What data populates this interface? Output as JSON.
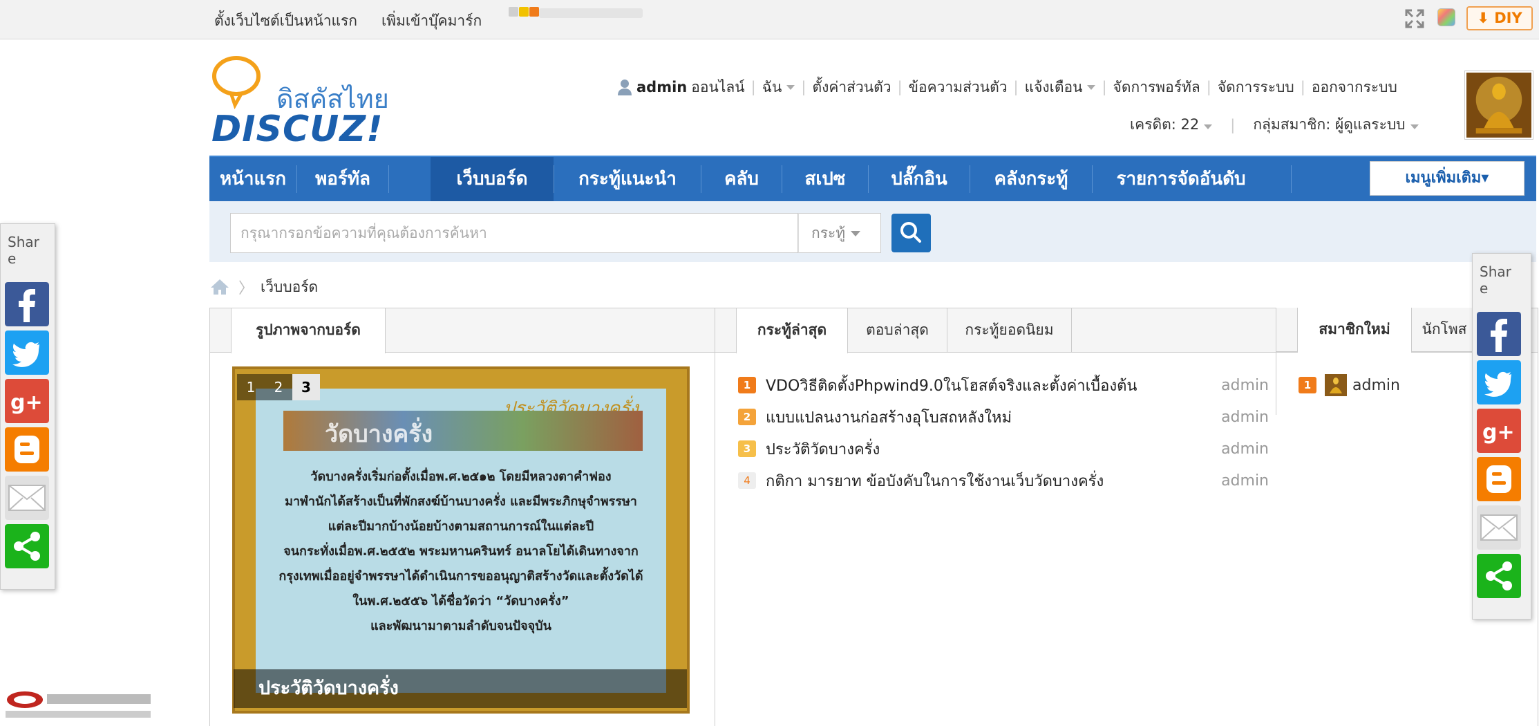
{
  "topbar": {
    "set_homepage": "ตั้งเว็บไซต์เป็นหน้าแรก",
    "add_bookmark": "เพิ่มเข้าบุ๊คมาร์ก",
    "diy_label": "DIY"
  },
  "logo": {
    "thai": "ดิสคัสไทย",
    "text": "DISCUZ!"
  },
  "user_menu": {
    "username": "admin",
    "status": "ออนไลน์",
    "items": [
      "ฉัน",
      "ตั้งค่าส่วนตัว",
      "ข้อความส่วนตัว",
      "แจ้งเตือน",
      "จัดการพอร์ทัล",
      "จัดการระบบ",
      "ออกจากระบบ"
    ],
    "credit": "เครดิต: 22",
    "group": "กลุ่มสมาชิก: ผู้ดูแลระบบ"
  },
  "nav": {
    "items": [
      "หน้าแรก",
      "พอร์ทัล",
      "เว็บบอร์ด",
      "กระทู้แนะนำ",
      "คลับ",
      "สเปซ",
      "ปลั๊กอิน",
      "คลังกระทู้",
      "รายการจัดอันดับ"
    ],
    "active_index": 2,
    "more": "เมนูเพิ่มเติม▾"
  },
  "search": {
    "placeholder": "กรุณากรอกข้อความที่คุณต้องการค้นหา",
    "type": "กระทู้"
  },
  "breadcrumb": {
    "current": "เว็บบอร์ด"
  },
  "panel_images": {
    "tab": "รูปภาพจากบอร์ด",
    "slide_numbers": [
      "1",
      "2",
      "3"
    ],
    "active_slide": 3,
    "slide_title_script": "ประวัติวัดบางครั่ง",
    "slide_heading": "วัดบางครั่ง",
    "slide_lines": [
      "วัดบางครั่งเริ่มก่อตั้งเมื่อพ.ศ.๒๕๑๒ โดยมีหลวงตาคำฟอง",
      "มาพำนักได้สร้างเป็นที่พักสงฆ์บ้านบางครั่ง และมีพระภิกษุจำพรรษา",
      "แต่ละปีมากบ้างน้อยบ้างตามสถานการณ์ในแต่ละปี",
      "จนกระทั่งเมื่อพ.ศ.๒๕๕๒ พระมหานครินทร์ อนาลโยได้เดินทางจาก",
      "กรุงเทพเมื่ออยู่จำพรรษาได้ดำเนินการขออนุญาติสร้างวัดและตั้งวัดได้",
      "ในพ.ศ.๒๕๕๖ ได้ชื่อวัดว่า “วัดบางครั่ง”",
      "และพัฒนามาตามลำดับจนปัจจุบัน"
    ],
    "caption": "ประวัติวัดบางครั่ง"
  },
  "panel_threads": {
    "tabs": [
      "กระทู้ล่าสุด",
      "ตอบล่าสุด",
      "กระทู้ยอดนิยม"
    ],
    "threads": [
      {
        "rank": "1",
        "title": "VDOวิธีติดตั้งPhpwind9.0ในโฮสต์จริงและตั้งค่าเบื้องต้น",
        "author": "admin",
        "color": "#f07b1a"
      },
      {
        "rank": "2",
        "title": "แบบแปลนงานก่อสร้างอุโบสถหลังใหม่",
        "author": "admin",
        "color": "#f4a33a"
      },
      {
        "rank": "3",
        "title": "ประวัติวัดบางครั่ง",
        "author": "admin",
        "color": "#f6bf4a"
      },
      {
        "rank": "4",
        "title": "กติกา มารยาท ข้อบังคับในการใช้งานเว็บวัดบางครั่ง",
        "author": "admin",
        "color": "#eeeeee"
      }
    ]
  },
  "panel_members": {
    "tabs": [
      "สมาชิกใหม่",
      "นักโพส"
    ],
    "members": [
      {
        "rank": "1",
        "name": "admin"
      }
    ]
  },
  "share": {
    "label": "Share"
  },
  "colors": {
    "nav_bg": "#2b6fbd",
    "nav_active": "#1d5aa4",
    "facebook": "#3b5998",
    "twitter": "#1da1f2",
    "googleplus": "#dd4b39",
    "blogger": "#f57d00",
    "email": "#e0e0e0",
    "sharethis": "#1bb31b"
  }
}
